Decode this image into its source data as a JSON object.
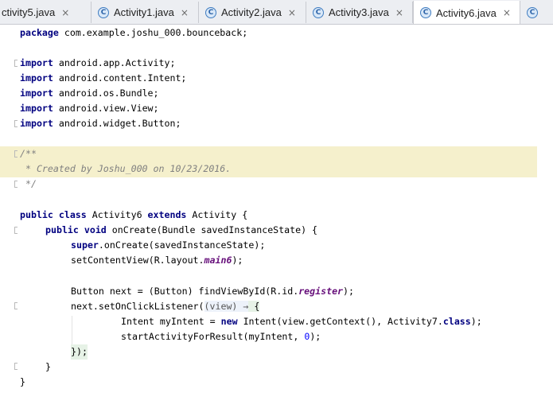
{
  "tabs": [
    {
      "label": "ctivity5.java",
      "close": "×",
      "active": false,
      "has_icon": false
    },
    {
      "label": "Activity1.java",
      "close": "×",
      "active": false,
      "has_icon": true
    },
    {
      "label": "Activity2.java",
      "close": "×",
      "active": false,
      "has_icon": true
    },
    {
      "label": "Activity3.java",
      "close": "×",
      "active": false,
      "has_icon": true
    },
    {
      "label": "Activity6.java",
      "close": "×",
      "active": true,
      "has_icon": true
    },
    {
      "label": "",
      "close": "",
      "active": false,
      "has_icon": true
    }
  ],
  "tab_icon_letter": "C",
  "code": {
    "l1_kw": "package",
    "l1_rest": " com.example.joshu_000.bounceback;",
    "imports": [
      {
        "kw": "import",
        "rest": " android.app.Activity;"
      },
      {
        "kw": "import",
        "rest": " android.content.Intent;"
      },
      {
        "kw": "import",
        "rest": " android.os.Bundle;"
      },
      {
        "kw": "import",
        "rest": " android.view.View;"
      },
      {
        "kw": "import",
        "rest": " android.widget.Button;"
      }
    ],
    "doc_open": "/**",
    "doc_body": " * Created by Joshu_000 on 10/23/2016.",
    "doc_close": " */",
    "class_kw1": "public class",
    "class_name": " Activity6 ",
    "class_kw2": "extends",
    "class_rest": " Activity {",
    "method_kw": "public void",
    "method_rest": " onCreate(Bundle savedInstanceState) {",
    "super_kw": "super",
    "super_rest": ".onCreate(savedInstanceState);",
    "setcv_a": "setContentView(R.layout.",
    "setcv_field": "main6",
    "setcv_b": ");",
    "btn_a": "Button next = (Button) findViewById(R.id.",
    "btn_field": "register",
    "btn_b": ");",
    "listener_a": "next.setOnClickListener(",
    "listener_param": "(view) →",
    "listener_b": " {",
    "intent_a": "Intent myIntent = ",
    "intent_new": "new",
    "intent_b": " Intent(view.getContext(), Activity7.",
    "intent_class": "class",
    "intent_c": ");",
    "start_a": "startActivityForResult(myIntent, ",
    "start_num": "0",
    "start_b": ");",
    "close_lambda": "});",
    "close_method": "}",
    "close_class": "}"
  }
}
